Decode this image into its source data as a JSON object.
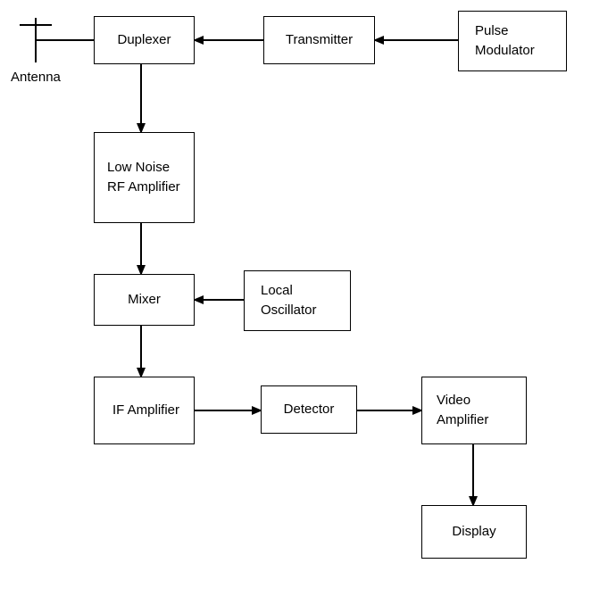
{
  "diagram": {
    "antenna_label": "Antenna",
    "blocks": {
      "duplexer": "Duplexer",
      "transmitter": "Transmitter",
      "pulse_modulator": "Pulse Modulator",
      "low_noise_rf_amp": "Low Noise RF Amplifier",
      "mixer": "Mixer",
      "local_oscillator": "Local Oscillator",
      "if_amplifier": "IF Amplifier",
      "detector": "Detector",
      "video_amplifier": "Video Amplifier",
      "display": "Display"
    }
  }
}
